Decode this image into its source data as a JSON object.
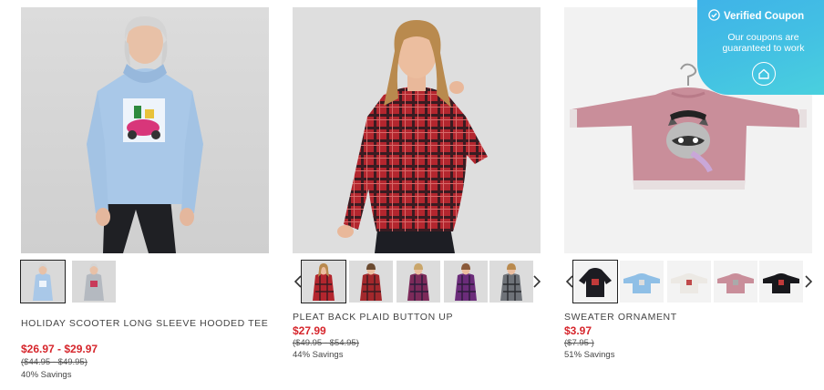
{
  "products": [
    {
      "title": "HOLIDAY SCOOTER LONG SLEEVE HOODED TEE",
      "price": "$26.97 - $29.97",
      "was_price": "($44.95 - $49.95)",
      "savings": "40% Savings"
    },
    {
      "title": "PLEAT BACK PLAID BUTTON UP",
      "price": "$27.99",
      "was_price": "($49.95 - $54.95)",
      "savings": "44% Savings"
    },
    {
      "title": "SWEATER ORNAMENT",
      "price": "$3.97",
      "was_price": "($7.95 )",
      "savings": "51% Savings"
    }
  ],
  "coupon": {
    "heading": "Verified Coupon",
    "line1": "Our coupons are",
    "line2": "guaranteed to work"
  },
  "icons": {
    "prev": "chevron-left-icon",
    "next": "chevron-right-icon",
    "verified": "check-circle-icon",
    "logo": "house-icon"
  },
  "colors": {
    "price": "#d6262c",
    "coupon_bg": "#43c1e3",
    "text": "#444444"
  }
}
